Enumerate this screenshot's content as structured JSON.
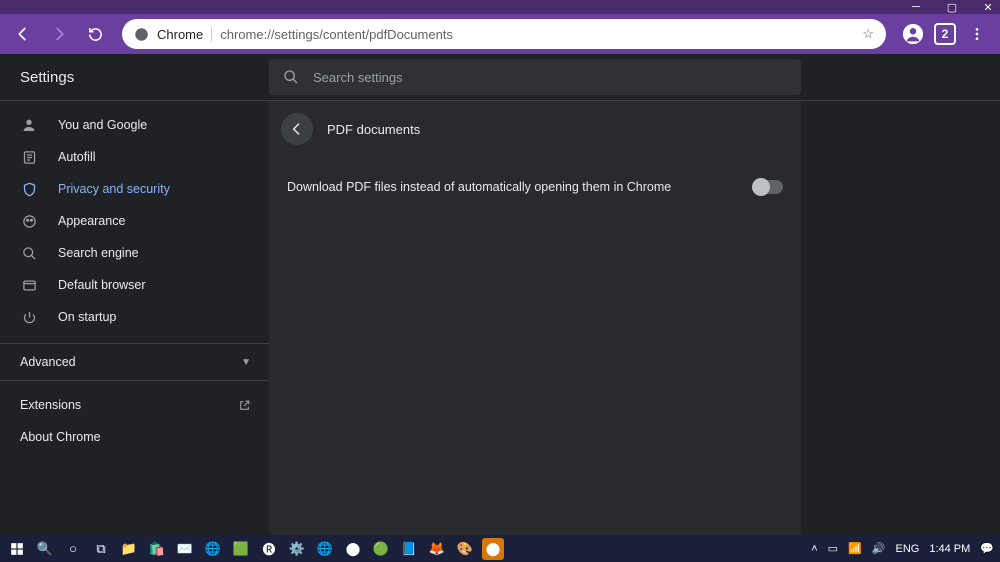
{
  "window": {
    "tab_count": "2"
  },
  "toolbar": {
    "chrome_label": "Chrome",
    "url": "chrome://settings/content/pdfDocuments"
  },
  "settings": {
    "title": "Settings",
    "search_placeholder": "Search settings",
    "sidebar": {
      "items": [
        {
          "label": "You and Google"
        },
        {
          "label": "Autofill"
        },
        {
          "label": "Privacy and security"
        },
        {
          "label": "Appearance"
        },
        {
          "label": "Search engine"
        },
        {
          "label": "Default browser"
        },
        {
          "label": "On startup"
        }
      ],
      "advanced": "Advanced",
      "extensions": "Extensions",
      "about": "About Chrome"
    },
    "panel": {
      "title": "PDF documents",
      "option": "Download PDF files instead of automatically opening them in Chrome"
    }
  },
  "taskbar": {
    "lang": "ENG",
    "time": "1:44 PM"
  }
}
